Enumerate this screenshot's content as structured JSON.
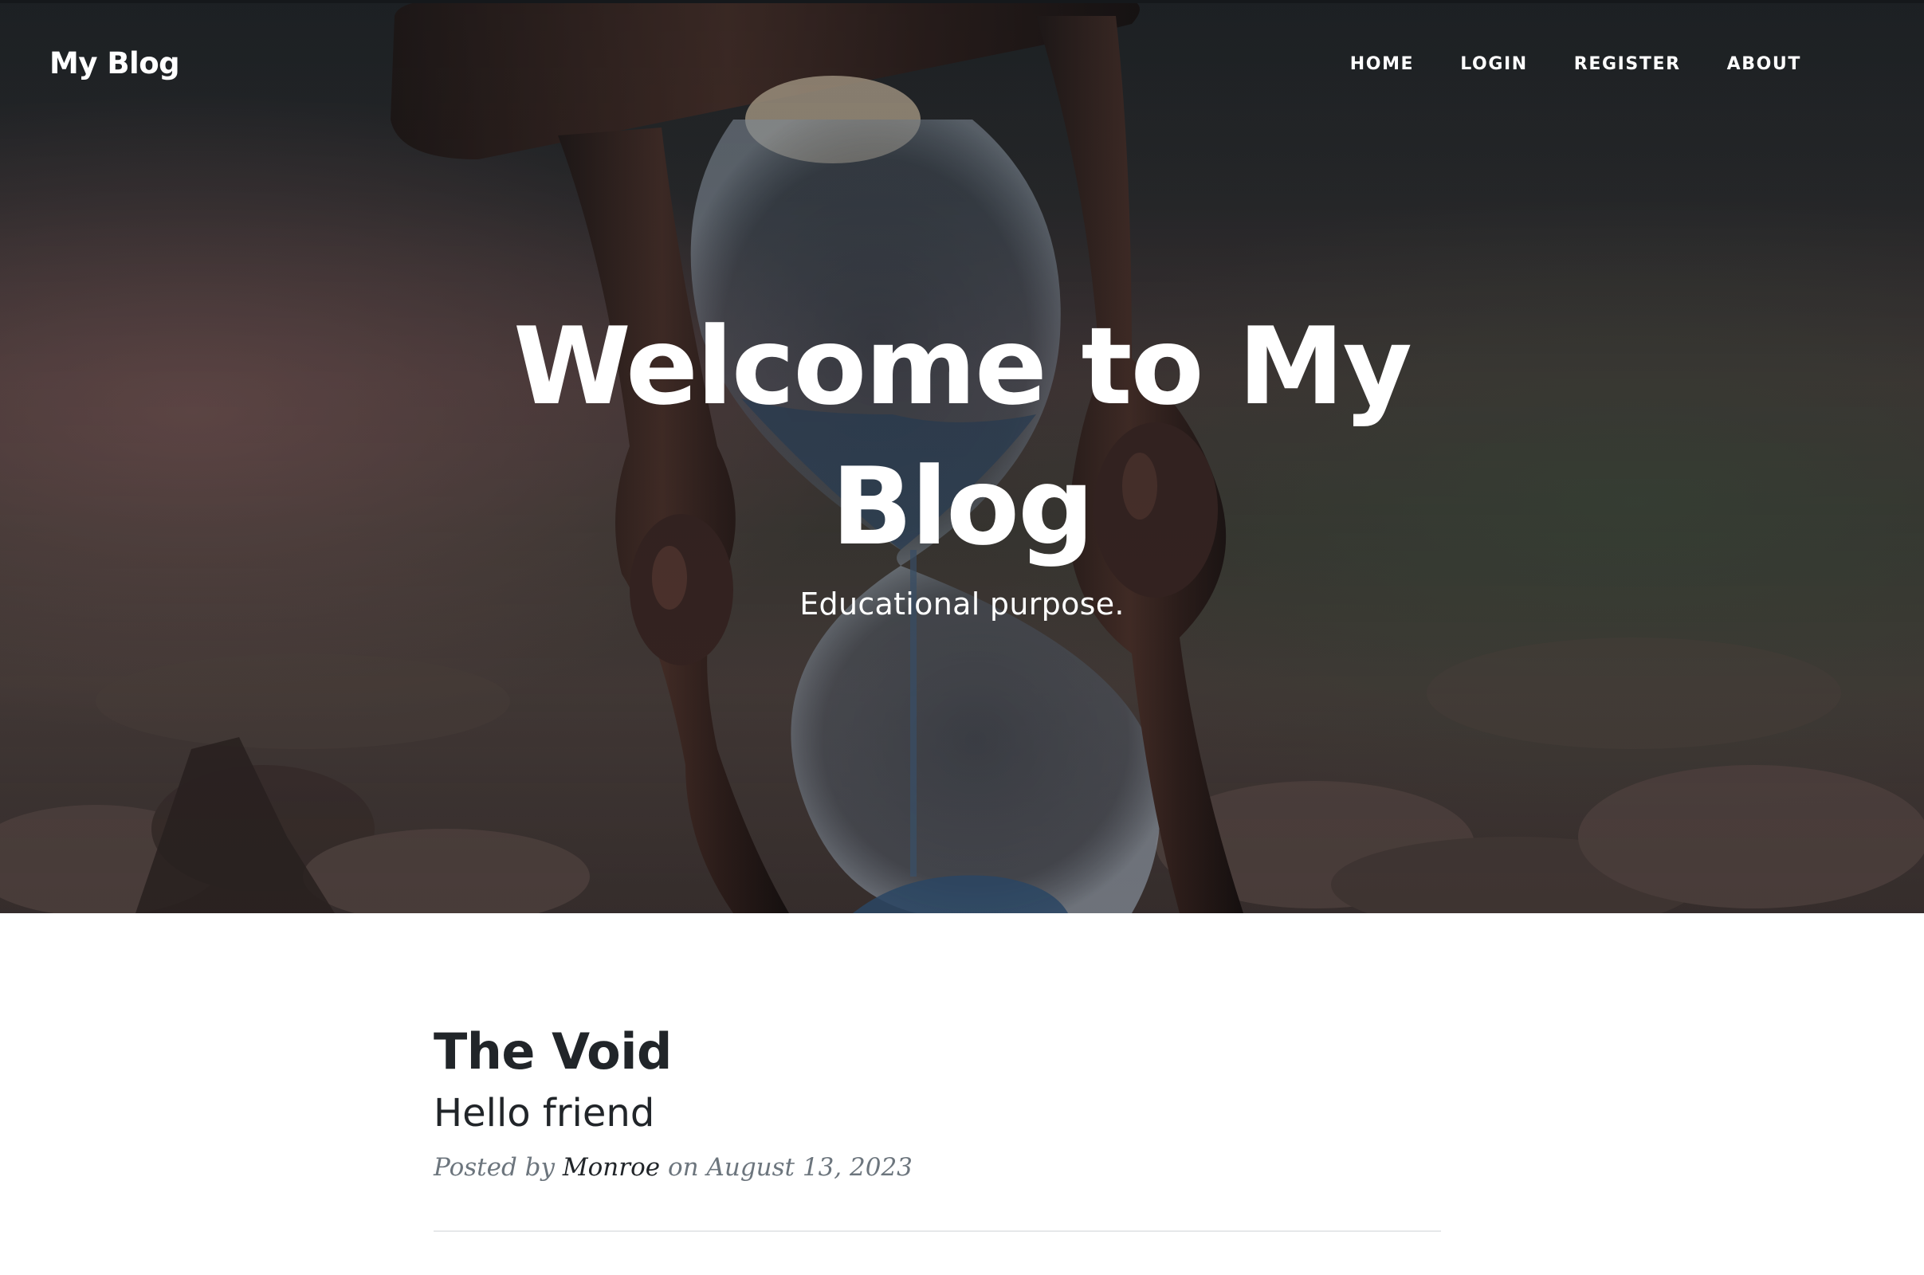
{
  "navbar": {
    "brand": "My Blog",
    "items": [
      {
        "label": "HOME"
      },
      {
        "label": "LOGIN"
      },
      {
        "label": "REGISTER"
      },
      {
        "label": "ABOUT"
      }
    ]
  },
  "hero": {
    "title": "Welcome to My Blog",
    "subtitle": "Educational purpose.",
    "background_image": "hourglass-photo"
  },
  "posts": [
    {
      "title": "The Void",
      "subtitle": "Hello friend",
      "meta_prefix": "Posted by",
      "author": "Monroe",
      "meta_on": "on",
      "date": "August 13, 2023"
    }
  ],
  "colors": {
    "text_dark": "#212529",
    "text_muted": "#6c757d",
    "hero_overlay": "#212529",
    "divider": "#e6e8ea"
  }
}
